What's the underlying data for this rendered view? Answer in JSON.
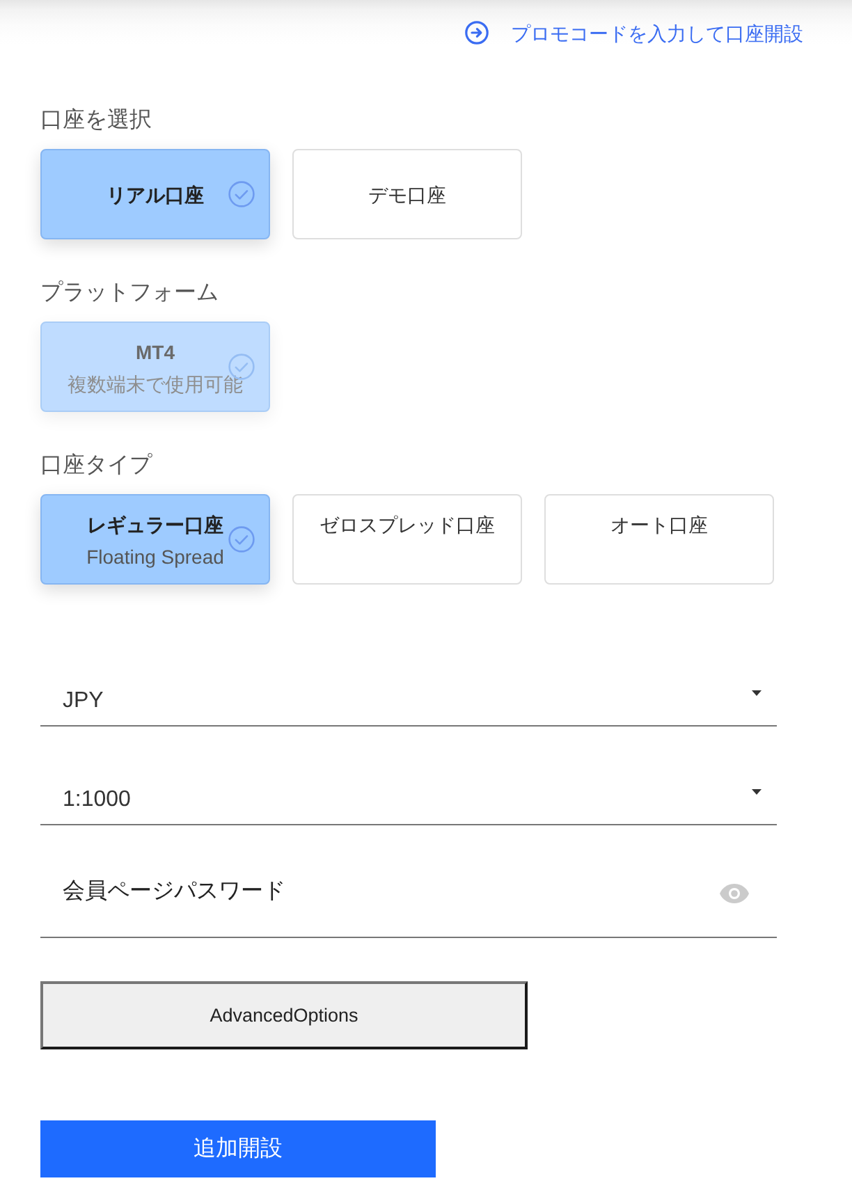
{
  "promo_link": {
    "label": "プロモコードを入力して口座開設"
  },
  "sections": [
    {
      "label": "口座を選択",
      "options": [
        {
          "title": "リアル口座",
          "selected": true,
          "disabled": false
        },
        {
          "title": "デモ口座",
          "selected": false,
          "disabled": false
        }
      ]
    },
    {
      "label": "プラットフォーム",
      "options": [
        {
          "title": "MT4",
          "subtitle": "複数端末で使用可能",
          "selected": true,
          "disabled": true
        }
      ]
    },
    {
      "label": "口座タイプ",
      "options": [
        {
          "title": "レギュラー口座",
          "subtitle": "Floating Spread",
          "selected": true,
          "disabled": false
        },
        {
          "title": "ゼロスプレッド口座",
          "selected": false,
          "disabled": false
        },
        {
          "title": "オート口座",
          "selected": false,
          "disabled": false
        }
      ]
    }
  ],
  "fields": [
    {
      "kind": "select",
      "value": "JPY"
    },
    {
      "kind": "select",
      "value": "1:1000"
    },
    {
      "kind": "password",
      "placeholder": "会員ページパスワード"
    }
  ],
  "buttons": [
    {
      "kind": "secondary",
      "label": "AdvancedOptions"
    },
    {
      "kind": "primary",
      "label": "追加開設"
    }
  ]
}
